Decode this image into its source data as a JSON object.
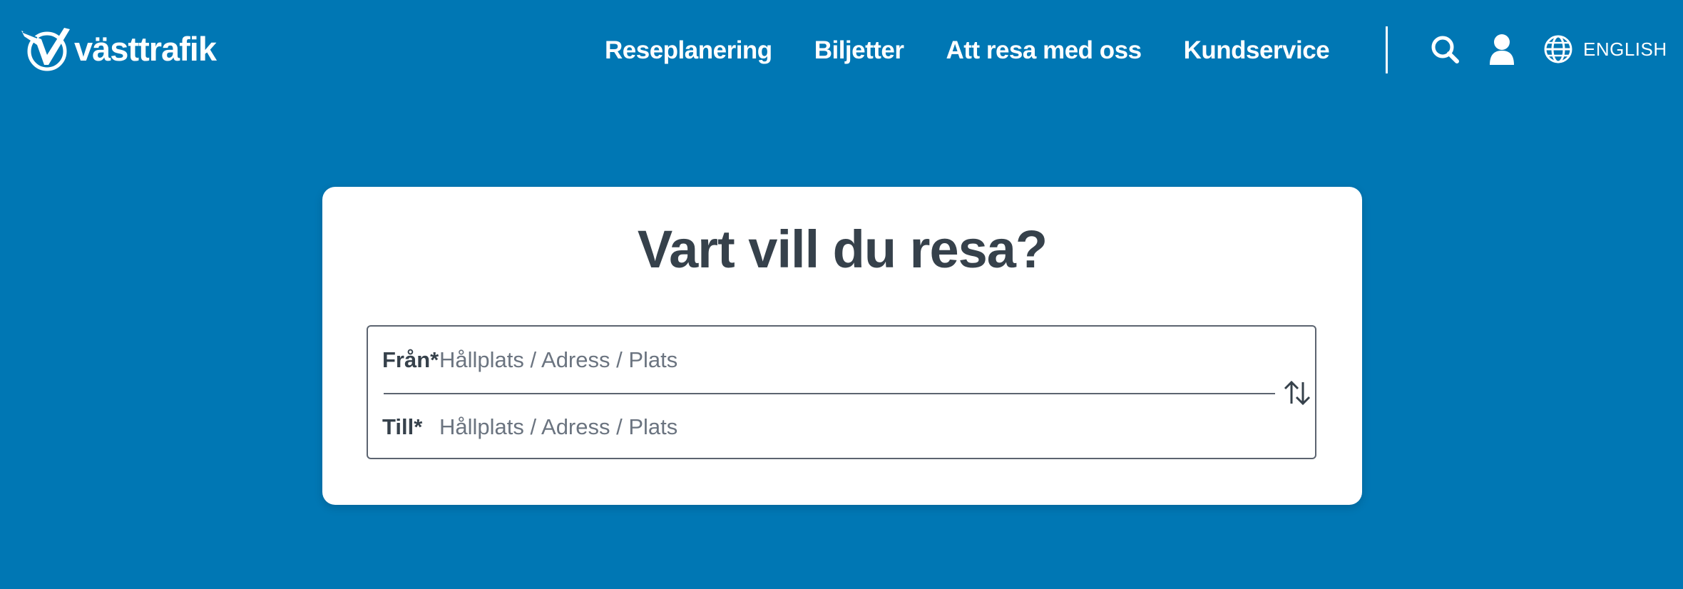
{
  "header": {
    "logo_text": "västtrafik",
    "nav": [
      {
        "label": "Reseplanering"
      },
      {
        "label": "Biljetter"
      },
      {
        "label": "Att resa med oss"
      },
      {
        "label": "Kundservice"
      }
    ],
    "icons": {
      "logo": "vasttrafik-logo-icon",
      "search": "search-icon",
      "user": "user-icon",
      "language": "globe-icon"
    },
    "language_label": "ENGLISH"
  },
  "planner": {
    "title": "Vart vill du resa?",
    "from": {
      "label": "Från*",
      "placeholder": "Hållplats / Adress / Plats",
      "value": ""
    },
    "to": {
      "label": "Till*",
      "placeholder": "Hållplats / Adress / Plats",
      "value": ""
    },
    "swap_icon": "swap-arrows-icon"
  },
  "colors": {
    "background": "#0077b4",
    "card": "#ffffff",
    "text_dark": "#36414b",
    "placeholder": "#6b7480",
    "border": "#5c6470"
  }
}
